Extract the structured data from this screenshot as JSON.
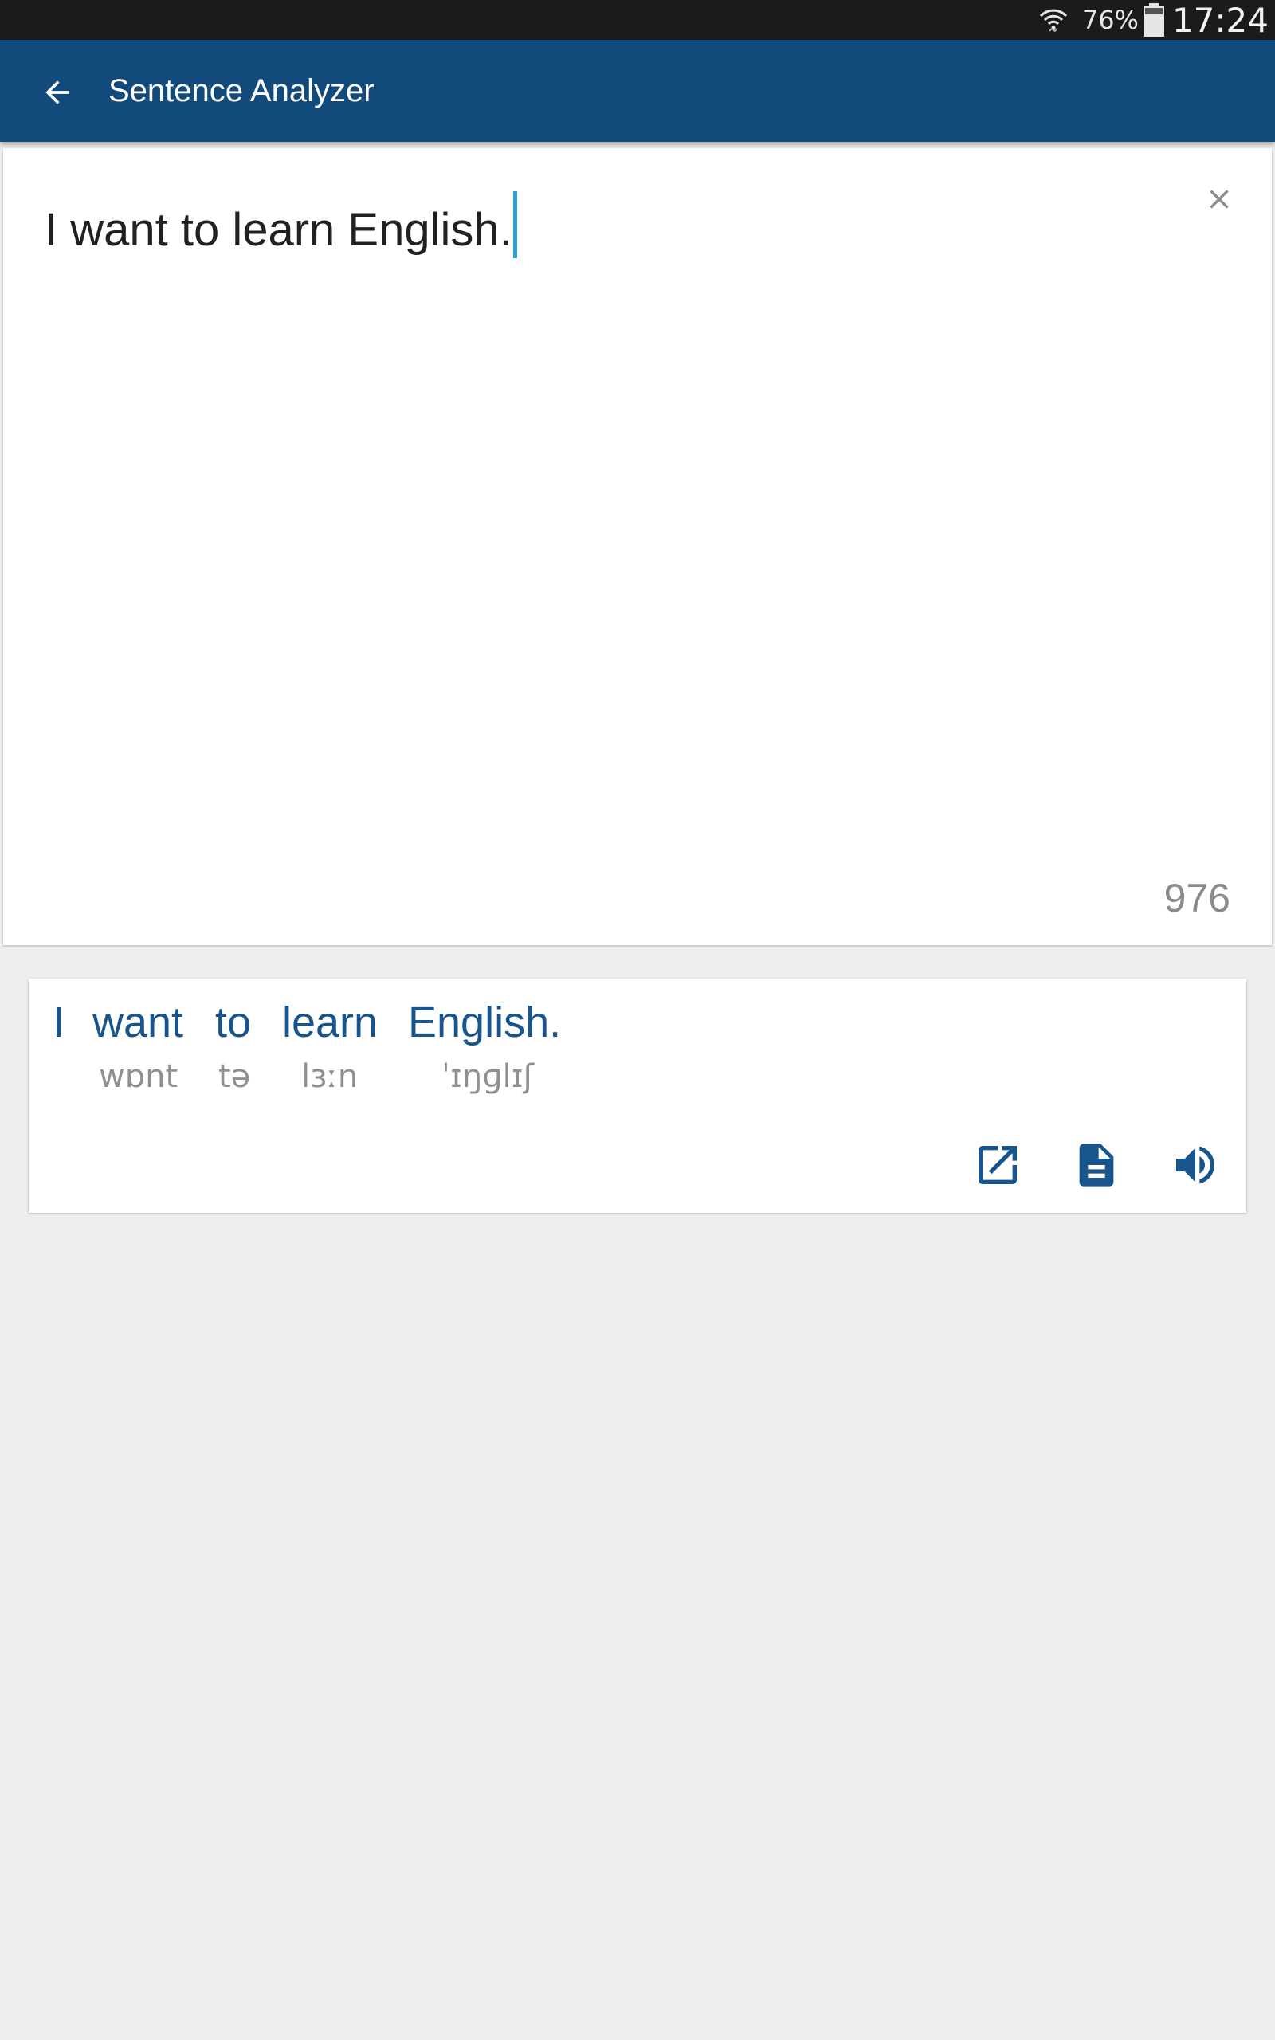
{
  "status_bar": {
    "battery_percent": "76%",
    "time": "17:24",
    "icons": [
      "wifi-icon",
      "battery-icon"
    ]
  },
  "app_bar": {
    "title": "Sentence Analyzer",
    "back_icon": "arrow-back-icon",
    "color": "#134a7c"
  },
  "input": {
    "text": "I want to learn English.",
    "char_remaining": "976",
    "clear_icon": "close-icon",
    "caret_color": "#2f9ed9"
  },
  "result": {
    "words": [
      {
        "word": "I",
        "phonetic": ""
      },
      {
        "word": "want",
        "phonetic": "wɒnt"
      },
      {
        "word": "to",
        "phonetic": "tə"
      },
      {
        "word": "learn",
        "phonetic": "lɜːn"
      },
      {
        "word": "English.",
        "phonetic": "ˈɪŋɡlɪʃ"
      }
    ],
    "actions": [
      "open-external-icon",
      "document-icon",
      "volume-up-icon"
    ],
    "accent_color": "#17558c"
  }
}
